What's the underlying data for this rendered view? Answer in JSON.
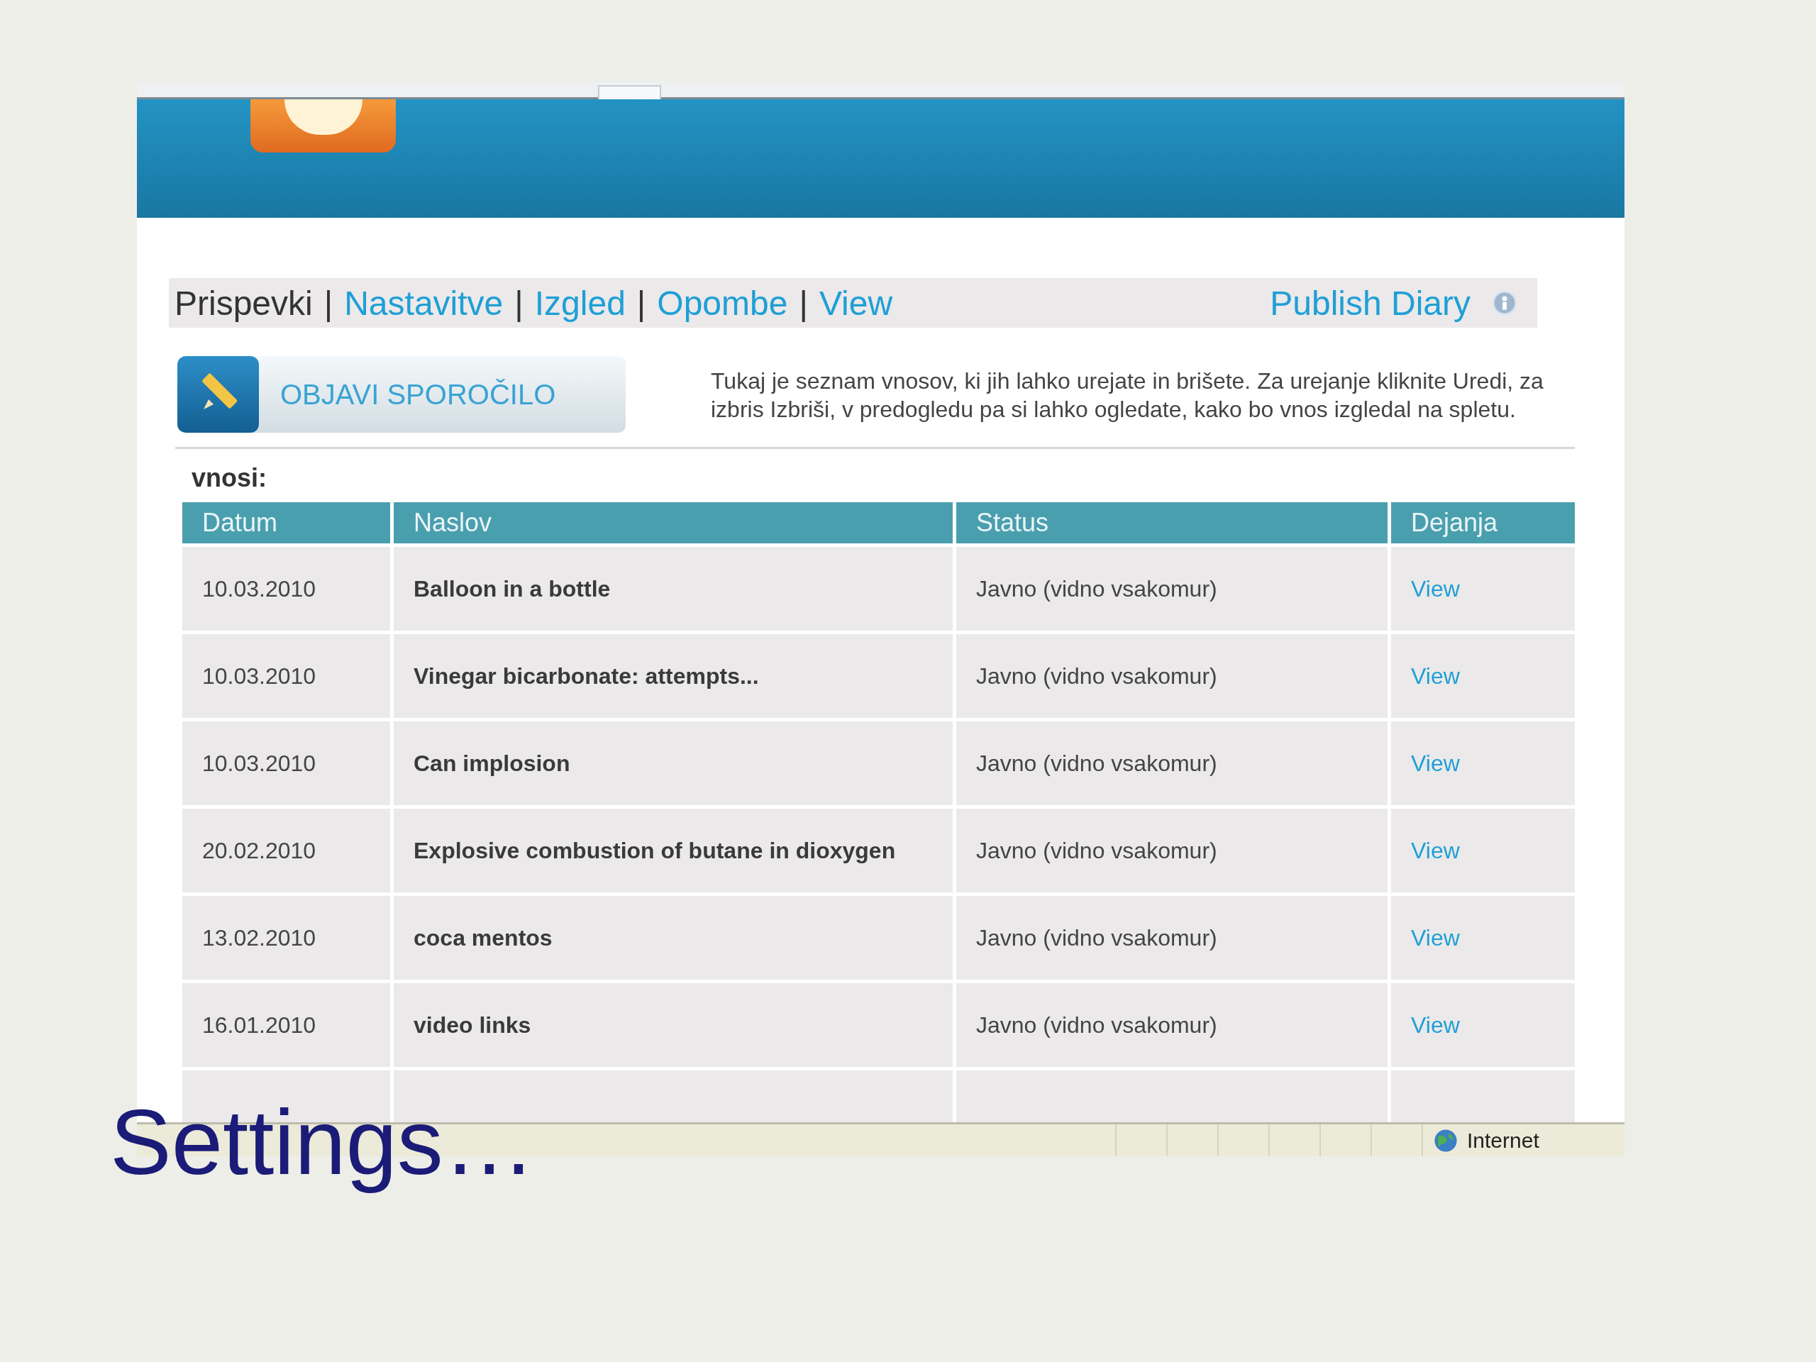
{
  "nav": {
    "separator": "|",
    "items": [
      {
        "label": "Prispevki",
        "selected": true
      },
      {
        "label": "Nastavitve",
        "selected": false
      },
      {
        "label": "Izgled",
        "selected": false
      },
      {
        "label": "Opombe",
        "selected": false
      },
      {
        "label": "View",
        "selected": false
      }
    ],
    "publish_label": "Publish Diary"
  },
  "post_button": {
    "label": "OBJAVI SPOROČILO"
  },
  "description": "Tukaj je seznam vnosov, ki jih lahko urejate in brišete. Za urejanje kliknite Uredi, za izbris Izbriši, v predogledu pa si lahko ogledate, kako bo vnos izgledal na spletu.",
  "section_label": "vnosi:",
  "table": {
    "columns": [
      "Datum",
      "Naslov",
      "Status",
      "Dejanja"
    ],
    "rows": [
      {
        "date": "10.03.2010",
        "title": "Balloon in a bottle",
        "status": "Javno (vidno vsakomur)",
        "action": "View"
      },
      {
        "date": "10.03.2010",
        "title": "Vinegar bicarbonate: attempts...",
        "status": "Javno (vidno vsakomur)",
        "action": "View"
      },
      {
        "date": "10.03.2010",
        "title": "Can implosion",
        "status": "Javno (vidno vsakomur)",
        "action": "View"
      },
      {
        "date": "20.02.2010",
        "title": "Explosive combustion of butane in dioxygen",
        "status": "Javno (vidno vsakomur)",
        "action": "View"
      },
      {
        "date": "13.02.2010",
        "title": "coca mentos",
        "status": "Javno (vidno vsakomur)",
        "action": "View"
      },
      {
        "date": "16.01.2010",
        "title": "video links",
        "status": "Javno (vidno vsakomur)",
        "action": "View"
      }
    ]
  },
  "status_bar": {
    "zone": "Internet"
  },
  "slide": {
    "caption": "Settings…"
  }
}
